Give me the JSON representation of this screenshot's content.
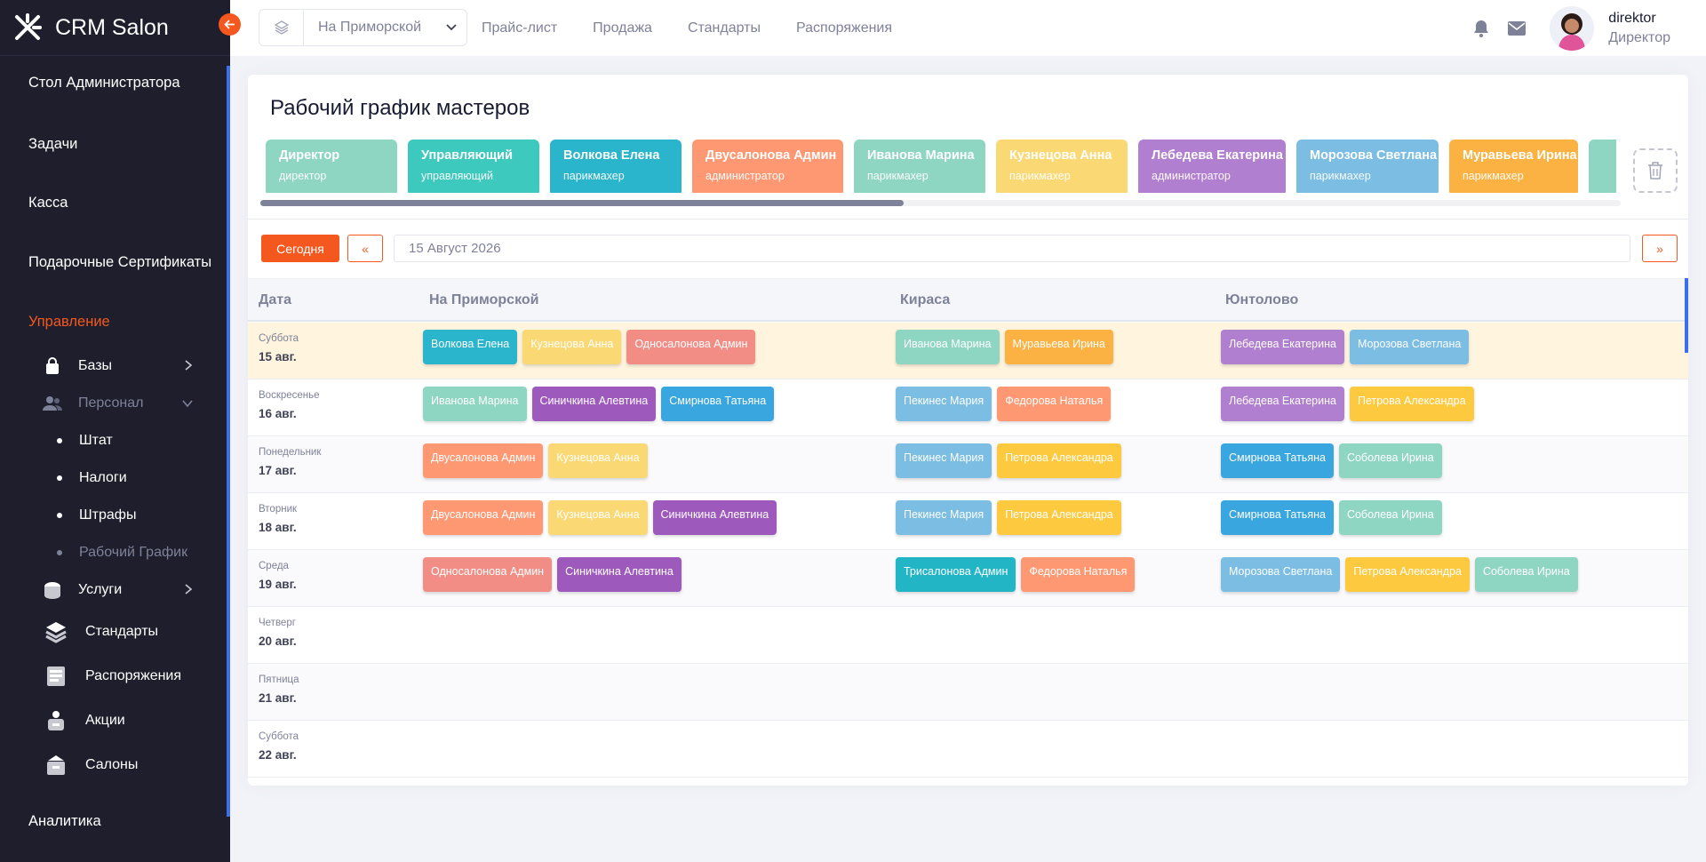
{
  "app": {
    "name": "CRM Salon"
  },
  "sidebar": {
    "items": [
      {
        "label": "Стол Администратора"
      },
      {
        "label": "Задачи"
      },
      {
        "label": "Касса"
      },
      {
        "label": "Подарочные Сертификаты"
      },
      {
        "label": "Управление"
      }
    ],
    "sub": [
      {
        "label": "Базы"
      },
      {
        "label": "Персонал"
      },
      {
        "label": "Штат"
      },
      {
        "label": "Налоги"
      },
      {
        "label": "Штрафы"
      },
      {
        "label": "Рабочий График"
      },
      {
        "label": "Услуги"
      },
      {
        "label": "Стандарты"
      },
      {
        "label": "Распоряжения"
      },
      {
        "label": "Акции"
      },
      {
        "label": "Салоны"
      }
    ],
    "bottom": {
      "label": "Аналитика"
    }
  },
  "topbar": {
    "branch": "На Приморской",
    "nav": [
      "Прайс-лист",
      "Продажа",
      "Стандарты",
      "Распоряжения"
    ],
    "user": {
      "name": "direktor",
      "role": "Директор"
    }
  },
  "page": {
    "title": "Рабочий график мастеров",
    "today_btn": "Сегодня",
    "prev_btn": "«",
    "next_btn": "»",
    "date": "15 Август 2026"
  },
  "masters": [
    {
      "name": "Директор",
      "role": "директор",
      "color": "#8fd6c2"
    },
    {
      "name": "Управляющий",
      "role": "управляющий",
      "color": "#3ec9be"
    },
    {
      "name": "Волкова Елена",
      "role": "парикмахер",
      "color": "#2bb5cc"
    },
    {
      "name": "Двусалонова Админ",
      "role": "администратор",
      "color": "#fd9873"
    },
    {
      "name": "Иванова Марина",
      "role": "парикмахер",
      "color": "#8fd6c2"
    },
    {
      "name": "Кузнецова Анна",
      "role": "парикмахер",
      "color": "#fad874"
    },
    {
      "name": "Лебедева Екатерина",
      "role": "администратор",
      "color": "#b17fcf"
    },
    {
      "name": "Морозова Светлана",
      "role": "парикмахер",
      "color": "#7bbde3"
    },
    {
      "name": "Муравьева Ирина",
      "role": "парикмахер",
      "color": "#fbb243"
    },
    {
      "name": "",
      "role": "",
      "color": "#8fd6c2"
    }
  ],
  "schedule": {
    "headers": [
      "Дата",
      "На Приморской",
      "Кираса",
      "Юнтолово"
    ],
    "rows": [
      {
        "dow": "Суббота",
        "date": "15 авг.",
        "cols": [
          [
            {
              "n": "Волкова Елена",
              "c": "#2bb5cc"
            },
            {
              "n": "Кузнецова Анна",
              "c": "#fad874"
            },
            {
              "n": "Односалонова Админ",
              "c": "#f28d86"
            }
          ],
          [
            {
              "n": "Иванова Марина",
              "c": "#8fd6c2"
            },
            {
              "n": "Муравьева Ирина",
              "c": "#fbb243"
            }
          ],
          [
            {
              "n": "Лебедева Екатерина",
              "c": "#b17fcf"
            },
            {
              "n": "Морозова Светлана",
              "c": "#7bbde3"
            }
          ]
        ]
      },
      {
        "dow": "Воскресенье",
        "date": "16 авг.",
        "cols": [
          [
            {
              "n": "Иванова Марина",
              "c": "#8fd6c2"
            },
            {
              "n": "Синичкина Алевтина",
              "c": "#9d59bb"
            },
            {
              "n": "Смирнова Татьяна",
              "c": "#39a6df"
            }
          ],
          [
            {
              "n": "Пекинес Мария",
              "c": "#7bbde3"
            },
            {
              "n": "Федорова Наталья",
              "c": "#fd9873"
            }
          ],
          [
            {
              "n": "Лебедева Екатерина",
              "c": "#b17fcf"
            },
            {
              "n": "Петрова Александра",
              "c": "#fcc93f"
            }
          ]
        ]
      },
      {
        "dow": "Понедельник",
        "date": "17 авг.",
        "cols": [
          [
            {
              "n": "Двусалонова Админ",
              "c": "#fd9873"
            },
            {
              "n": "Кузнецова Анна",
              "c": "#fad874"
            }
          ],
          [
            {
              "n": "Пекинес Мария",
              "c": "#7bbde3"
            },
            {
              "n": "Петрова Александра",
              "c": "#fcc93f"
            }
          ],
          [
            {
              "n": "Смирнова Татьяна",
              "c": "#39a6df"
            },
            {
              "n": "Соболева Ирина",
              "c": "#8fd6c2"
            }
          ]
        ]
      },
      {
        "dow": "Вторник",
        "date": "18 авг.",
        "cols": [
          [
            {
              "n": "Двусалонова Админ",
              "c": "#fd9873"
            },
            {
              "n": "Кузнецова Анна",
              "c": "#fad874"
            },
            {
              "n": "Синичкина Алевтина",
              "c": "#9d59bb"
            }
          ],
          [
            {
              "n": "Пекинес Мария",
              "c": "#7bbde3"
            },
            {
              "n": "Петрова Александра",
              "c": "#fcc93f"
            }
          ],
          [
            {
              "n": "Смирнова Татьяна",
              "c": "#39a6df"
            },
            {
              "n": "Соболева Ирина",
              "c": "#8fd6c2"
            }
          ]
        ]
      },
      {
        "dow": "Среда",
        "date": "19 авг.",
        "cols": [
          [
            {
              "n": "Односалонова Админ",
              "c": "#f28d86"
            },
            {
              "n": "Синичкина Алевтина",
              "c": "#9d59bb"
            }
          ],
          [
            {
              "n": "Трисалонова Админ",
              "c": "#21b5c5"
            },
            {
              "n": "Федорова Наталья",
              "c": "#fd9873"
            }
          ],
          [
            {
              "n": "Морозова Светлана",
              "c": "#7bbde3"
            },
            {
              "n": "Петрова Александра",
              "c": "#fcc93f"
            },
            {
              "n": "Соболева Ирина",
              "c": "#8fd6c2"
            }
          ]
        ]
      },
      {
        "dow": "Четверг",
        "date": "20 авг.",
        "cols": [
          [],
          [],
          []
        ]
      },
      {
        "dow": "Пятница",
        "date": "21 авг.",
        "cols": [
          [],
          [],
          []
        ]
      },
      {
        "dow": "Суббота",
        "date": "22 авг.",
        "cols": [
          [],
          [],
          []
        ]
      }
    ]
  },
  "colors": {
    "accent": "#f4581e",
    "sidebar_bg": "#1e1e2d",
    "today_row": "#fff4de"
  }
}
